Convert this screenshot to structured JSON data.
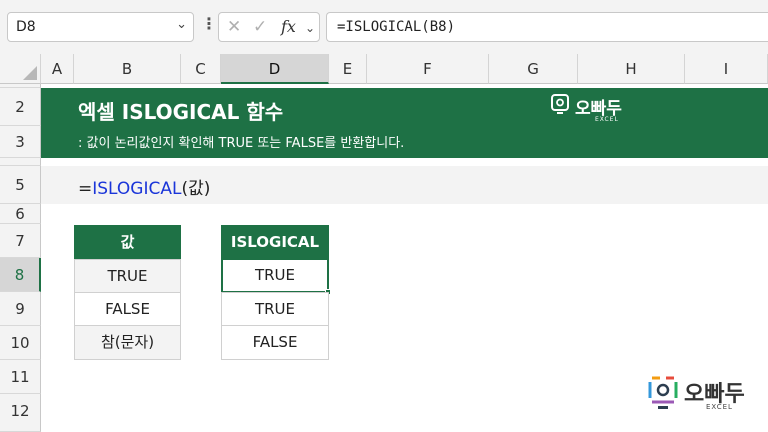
{
  "formula_bar": {
    "name_box": "D8",
    "fx_symbol": "fx",
    "formula": "=ISLOGICAL(B8)"
  },
  "columns": [
    "A",
    "B",
    "C",
    "D",
    "E",
    "F",
    "G",
    "H",
    "I"
  ],
  "rows": [
    "2",
    "3",
    "5",
    "6",
    "7",
    "8",
    "9",
    "10",
    "11",
    "12"
  ],
  "banner": {
    "title": "엑셀 ISLOGICAL 함수",
    "subtitle": ": 값이 논리값인지 확인해 TRUE 또는 FALSE를 반환합니다.",
    "logo_name": "오빠두",
    "logo_sub": "EXCEL"
  },
  "syntax": {
    "prefix": "=",
    "function": "ISLOGICAL",
    "args": "(값)"
  },
  "table_values": {
    "header": "값",
    "cells": [
      "TRUE",
      "FALSE",
      "참(문자)"
    ]
  },
  "table_results": {
    "header": "ISLOGICAL",
    "cells": [
      "TRUE",
      "TRUE",
      "FALSE"
    ]
  },
  "watermark": {
    "name": "오빠두",
    "sub": "EXCEL"
  },
  "colors": {
    "accent": "#1e7145",
    "function_blue": "#1a35d9"
  }
}
